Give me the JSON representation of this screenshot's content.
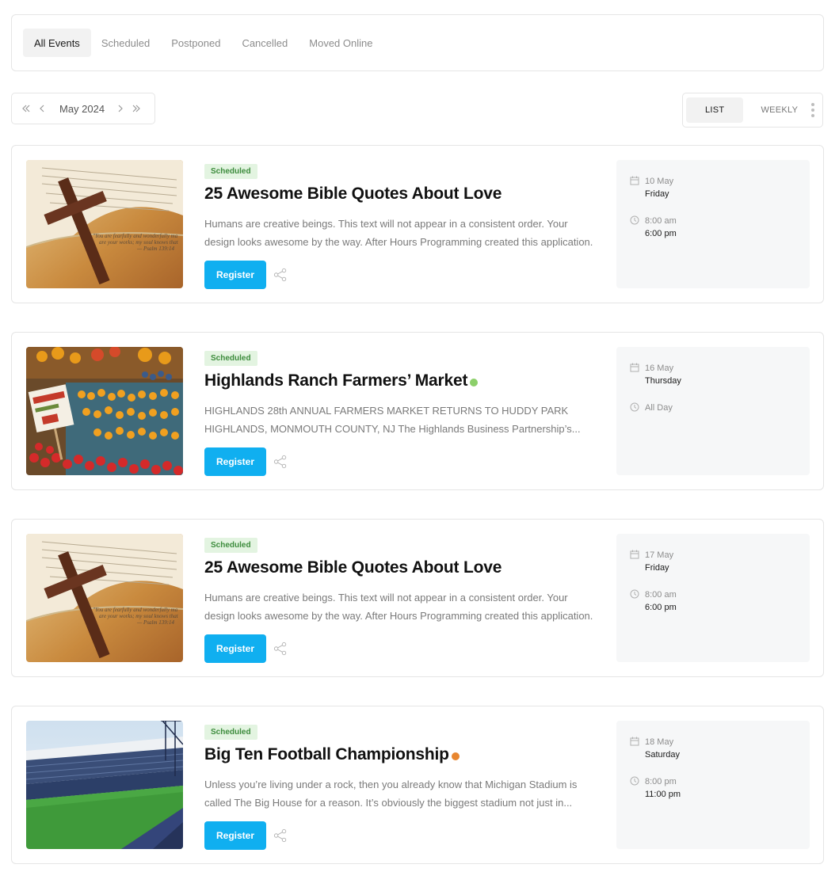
{
  "filters": {
    "tabs": [
      {
        "label": "All Events",
        "active": true
      },
      {
        "label": "Scheduled",
        "active": false
      },
      {
        "label": "Postponed",
        "active": false
      },
      {
        "label": "Cancelled",
        "active": false
      },
      {
        "label": "Moved Online",
        "active": false
      }
    ]
  },
  "month_nav": {
    "first_icon": "double-chevron-left-icon",
    "prev_icon": "chevron-left-icon",
    "label": "May 2024",
    "next_icon": "chevron-right-icon",
    "last_icon": "double-chevron-right-icon"
  },
  "view_toggle": {
    "list_label": "LIST",
    "weekly_label": "WEEKLY",
    "active": "list"
  },
  "colors": {
    "accent": "#10aff0",
    "badge_bg": "#e3f4e1",
    "badge_text": "#3d8c3d",
    "dot_green": "#8ccf6a",
    "dot_orange": "#e8862f"
  },
  "events": [
    {
      "badge": "Scheduled",
      "title": "25 Awesome Bible Quotes About Love",
      "dot": null,
      "image": "bible-cross-image",
      "desc_line1": "Humans are creative beings. This text will not appear in a consistent order. Your",
      "desc_line2": "design looks awesome by the way. After Hours Programming created this application.",
      "register_label": "Register",
      "date": "10 May",
      "weekday": "Friday",
      "time_start": "8:00 am",
      "time_end": "6:00 pm"
    },
    {
      "badge": "Scheduled",
      "title": "Highlands Ranch Farmers’ Market",
      "dot": "#8ccf6a",
      "image": "farmers-market-image",
      "desc_line1": "HIGHLANDS 28th ANNUAL FARMERS MARKET RETURNS TO HUDDY PARK",
      "desc_line2": "HIGHLANDS, MONMOUTH COUNTY, NJ The Highlands Business Partnership’s...",
      "register_label": "Register",
      "date": "16 May",
      "weekday": "Thursday",
      "time_start": "All Day",
      "time_end": ""
    },
    {
      "badge": "Scheduled",
      "title": "25 Awesome Bible Quotes About Love",
      "dot": null,
      "image": "bible-cross-image",
      "desc_line1": "Humans are creative beings. This text will not appear in a consistent order. Your",
      "desc_line2": "design looks awesome by the way. After Hours Programming created this application.",
      "register_label": "Register",
      "date": "17 May",
      "weekday": "Friday",
      "time_start": "8:00 am",
      "time_end": "6:00 pm"
    },
    {
      "badge": "Scheduled",
      "title": "Big Ten Football Championship",
      "dot": "#e8862f",
      "image": "stadium-image",
      "desc_line1": "Unless you’re living under a rock, then you already know that Michigan Stadium is",
      "desc_line2": "called The Big House for a reason. It’s obviously the biggest stadium not just in...",
      "register_label": "Register",
      "date": "18 May",
      "weekday": "Saturday",
      "time_start": "8:00 pm",
      "time_end": "11:00 pm"
    }
  ]
}
